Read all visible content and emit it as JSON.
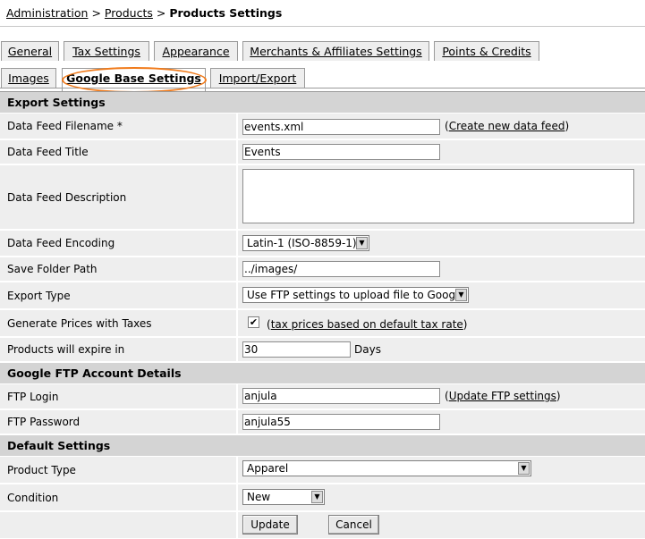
{
  "breadcrumb": {
    "admin": "Administration",
    "sep1": ">",
    "products": "Products",
    "sep2": ">",
    "current": "Products Settings"
  },
  "tabs": {
    "row1": [
      "General",
      "Tax Settings",
      "Appearance",
      "Merchants & Affiliates Settings",
      "Points & Credits"
    ],
    "row2": [
      "Images",
      "Google Base Settings",
      "Import/Export"
    ],
    "active": "Google Base Settings"
  },
  "sections": {
    "export": "Export Settings",
    "ftp": "Google FTP Account Details",
    "defaults": "Default Settings"
  },
  "fields": {
    "filename": {
      "label": "Data Feed Filename *",
      "value": "events.xml",
      "link_open": "(",
      "link": "Create new data feed",
      "link_close": ")"
    },
    "title": {
      "label": "Data Feed Title",
      "value": "Events"
    },
    "description": {
      "label": "Data Feed Description",
      "value": ""
    },
    "encoding": {
      "label": "Data Feed Encoding",
      "value": "Latin-1 (ISO-8859-1)"
    },
    "folder": {
      "label": "Save Folder Path",
      "value": "../images/"
    },
    "export_type": {
      "label": "Export Type",
      "value": "Use FTP settings to upload file to Google"
    },
    "taxes": {
      "label": "Generate Prices with Taxes",
      "checked": true,
      "link_open": "(",
      "link": "tax prices based on default tax rate",
      "link_close": ")"
    },
    "expire": {
      "label": "Products will expire in",
      "value": "30",
      "suffix": "Days"
    },
    "ftp_login": {
      "label": "FTP Login",
      "value": "anjula",
      "link_open": "(",
      "link": "Update FTP settings",
      "link_close": ")"
    },
    "ftp_password": {
      "label": "FTP Password",
      "value": "anjula55"
    },
    "product_type": {
      "label": "Product Type",
      "value": "Apparel"
    },
    "condition": {
      "label": "Condition",
      "value": "New"
    }
  },
  "buttons": {
    "update": "Update",
    "cancel": "Cancel"
  },
  "colors": {
    "highlight_oval": "#f07a1a",
    "row_bg": "#eeeeee",
    "section_bg": "#d4d4d4"
  }
}
